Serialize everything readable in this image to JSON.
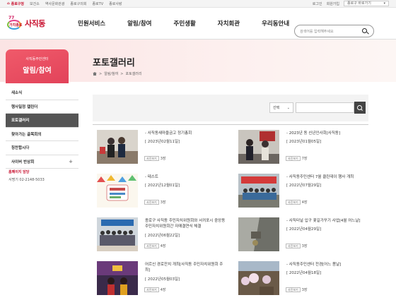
{
  "topbar": {
    "home_tab": "종로구청",
    "links": [
      "보건소",
      "역사문화관광",
      "종로구의회",
      "종로TV",
      "종로사랑"
    ],
    "login": "로그인",
    "signup": "회원가입",
    "shortcut": "종로구 바로가기"
  },
  "header": {
    "logo_number": "77",
    "logo_text": "가치종로",
    "site_name": "사직동",
    "nav": [
      "민원서비스",
      "알림/참여",
      "주민생활",
      "자치회관",
      "우리동안내"
    ],
    "search_placeholder": "검색어를 입력해주세요"
  },
  "lnb": {
    "subtitle": "사직동주민센터",
    "title": "알림/참여",
    "items": [
      {
        "label": "새소식"
      },
      {
        "label": "행사일정 캘린더"
      },
      {
        "label": "포토갤러리",
        "active": true
      },
      {
        "label": "찾아가는 골목회의"
      },
      {
        "label": "칭찬합시다"
      },
      {
        "label": "사이버 반상회",
        "plus": "+"
      }
    ],
    "contact_title": "홈페이지 담당",
    "contact_info": "서명기 02-2148-5033"
  },
  "page": {
    "title": "포토갤러리",
    "breadcrumb": [
      "알림/참여",
      "포토갤러리"
    ],
    "select_label": "선택",
    "chevron": "⌄"
  },
  "gallery": [
    {
      "title": "- 사직동새마을금고 정기총회",
      "date": "[ 2023년02월11일]",
      "tag": "사진보기",
      "count": "3장"
    },
    {
      "title": "- 2023년 동 신년인사회[사직동]",
      "date": "[ 2023년01월05일]",
      "tag": "사진보기",
      "count": "7장"
    },
    {
      "title": "- 테스트",
      "date": "[ 2022년12월01일]",
      "tag": "사진보기",
      "count": "3장"
    },
    {
      "title": "- 사직동주민센터 7월 클린데이 행사 개최",
      "date": "[ 2022년07월29일]",
      "tag": "사진보기",
      "count": "4장"
    },
    {
      "title": "종로구 사직동 주민자치위원회와 서귀포시 중앙동 주민자치위원회간 자매결연식 체결",
      "date": "[ 2022년06월22일]",
      "tag": "사진보기",
      "count": "4장"
    },
    {
      "title": "- 사직터널 입구 꽃길가꾸기 사업[4월 어느날]",
      "date": "[ 2022년04월29일]",
      "tag": "사진보기",
      "count": "3장"
    },
    {
      "title": "어르신 경로잔치 개최[사직동 주민자치위원회 주최]",
      "date": "[ 2022년05월03일]",
      "tag": "사진보기",
      "count": "4장"
    },
    {
      "title": "- 사직동주민센터 전경[어느 봄날]",
      "date": "[ 2022년04월18일]",
      "tag": "사진보기",
      "count": "3장"
    }
  ]
}
